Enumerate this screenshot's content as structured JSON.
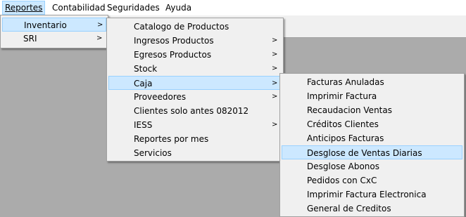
{
  "menubar": {
    "items": [
      {
        "label": "Reportes",
        "mnemonic": "R"
      },
      {
        "label": "Contabilidad"
      },
      {
        "label": "Seguridades",
        "mnemonic": "S"
      },
      {
        "label": "Ayuda",
        "mnemonic": "y"
      }
    ]
  },
  "menus": {
    "reportes": {
      "items": [
        {
          "label": "Inventario",
          "submenu": true,
          "selected": true
        },
        {
          "label": "SRI",
          "submenu": true
        }
      ]
    },
    "inventario": {
      "items": [
        {
          "label": "Catalogo de Productos"
        },
        {
          "label": "Ingresos Productos",
          "submenu": true
        },
        {
          "label": "Egresos Productos",
          "submenu": true
        },
        {
          "label": "Stock",
          "submenu": true
        },
        {
          "label": "Caja",
          "submenu": true,
          "selected": true
        },
        {
          "label": "Proveedores",
          "submenu": true
        },
        {
          "label": "Clientes solo antes 082012"
        },
        {
          "label": "IESS",
          "submenu": true
        },
        {
          "label": "Reportes por mes"
        },
        {
          "label": "Servicios"
        }
      ]
    },
    "caja": {
      "items": [
        {
          "label": "Facturas Anuladas"
        },
        {
          "label": "Imprimir Factura"
        },
        {
          "label": "Recaudacion Ventas"
        },
        {
          "label": "Créditos Clientes"
        },
        {
          "label": "Anticipos Facturas"
        },
        {
          "label": "Desglose de Ventas Diarias",
          "selected": true
        },
        {
          "label": "Desglose Abonos"
        },
        {
          "label": "Pedidos con CxC"
        },
        {
          "label": "Imprimir Factura Electronica"
        },
        {
          "label": "General de Creditos"
        }
      ]
    }
  },
  "icons": {
    "submenu_arrow": "chevron-right-icon"
  },
  "colors": {
    "workspace": "#ababab",
    "menu_bg": "#f0f0f0",
    "highlight": "#cce8ff",
    "highlight_border": "#99d1ff"
  }
}
